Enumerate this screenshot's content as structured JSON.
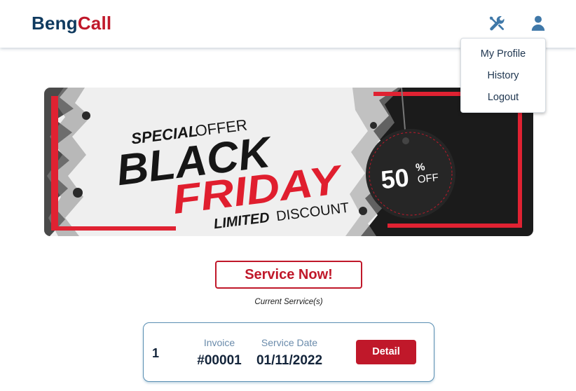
{
  "header": {
    "logo_part1": "Beng",
    "logo_part2": "Call",
    "tools_icon": "tools-icon",
    "user_icon": "user-icon"
  },
  "profile_menu": {
    "items": [
      {
        "label": "My Profile"
      },
      {
        "label": "History"
      },
      {
        "label": "Logout"
      }
    ]
  },
  "banner": {
    "line1_bold": "SPECIAL",
    "line1_light": "OFFER",
    "line2": "BLACK",
    "line3": "FRIDAY",
    "line4_bold": "LIMITED",
    "line4_light": "DISCOUNT",
    "tag_number": "50",
    "tag_percent": "%",
    "tag_off": "OFF"
  },
  "main": {
    "service_button": "Service Now!",
    "current_services_label": "Current Serrvice(s)"
  },
  "service_card": {
    "index": "1",
    "invoice_label": "Invoice",
    "invoice_value": "#00001",
    "date_label": "Service Date",
    "date_value": "01/11/2022",
    "detail_button": "Detail"
  },
  "colors": {
    "brand_dark": "#0f3a5f",
    "brand_red": "#c0182a",
    "card_border": "#5a8fb3"
  }
}
